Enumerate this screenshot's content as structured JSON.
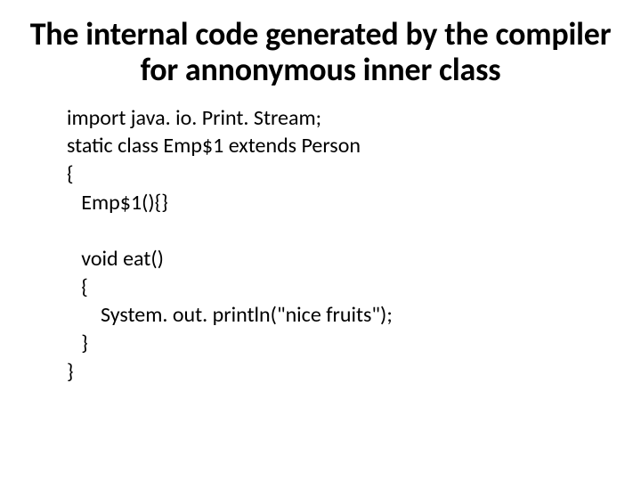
{
  "title": "The internal code generated by the compiler for annonymous inner class",
  "code": {
    "l1": "import java. io. Print. Stream;",
    "l2": "static class Emp$1 extends Person",
    "l3": "{",
    "l4": "   Emp$1(){}",
    "l5": "",
    "l6": "   void eat()",
    "l7": "   {",
    "l8": "       System. out. println(\"nice fruits\");",
    "l9": "   }",
    "l10": "}"
  }
}
